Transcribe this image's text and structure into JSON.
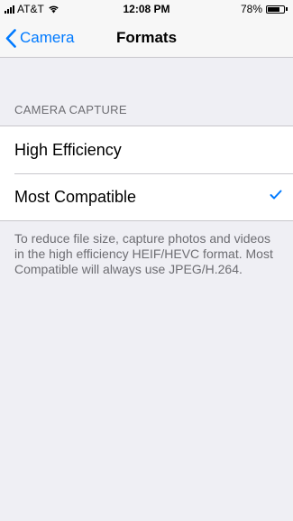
{
  "status_bar": {
    "carrier": "AT&T",
    "time": "12:08 PM",
    "battery": "78%",
    "battery_level": 0.78
  },
  "nav": {
    "back_label": "Camera",
    "title": "Formats"
  },
  "section": {
    "header": "CAMERA CAPTURE",
    "options": [
      {
        "label": "High Efficiency",
        "selected": false
      },
      {
        "label": "Most Compatible",
        "selected": true
      }
    ],
    "footer": "To reduce file size, capture photos and videos in the high efficiency HEIF/HEVC format. Most Compatible will always use JPEG/H.264."
  },
  "colors": {
    "accent": "#007aff",
    "background": "#efeff4",
    "secondary_text": "#6d6d72"
  },
  "icons": {
    "back": "chevron-left-icon",
    "selected": "checkmark-icon",
    "signal": "signal-bars-icon",
    "wifi": "wifi-icon",
    "battery": "battery-icon"
  }
}
